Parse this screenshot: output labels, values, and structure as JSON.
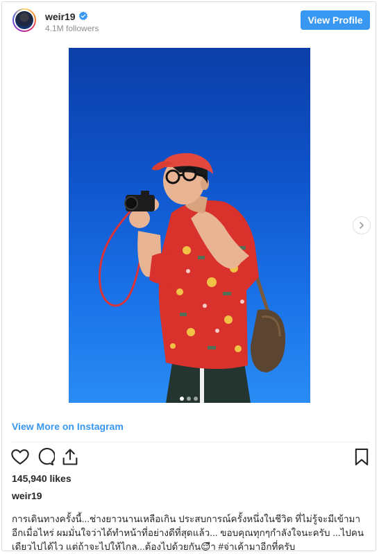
{
  "header": {
    "username": "weir19",
    "followers": "4.1M followers",
    "view_profile_label": "View Profile"
  },
  "post": {
    "carousel": {
      "count": 3,
      "active": 0
    },
    "view_more_label": "View More on Instagram",
    "likes": "145,940 likes",
    "author": "weir19",
    "caption": "การเดินทางครั้งนี้...ช่างยาวนานเหลือเกิน ประสบการณ์ครั้งหนึ่งในชีวิต ที่ไม่รู้จะมีเข้ามาอีกเมื่อไหร่ ผมมั่นใจว่าได้ทำหน้าที่อย่างดีที่สุดแล้ว... ขอบคุณทุกๆกำลังใจนะครับ ...ไปคนเดียวไปได้ไว แต่ถ้าจะไปให้ไกล...ต้องไปด้วยกัน😌ืา #จ่าเค้ามาอีกที่ครับ"
  },
  "icons": {
    "verified": "verified-badge-icon",
    "like": "heart-icon",
    "comment": "comment-icon",
    "share": "share-icon",
    "save": "bookmark-icon",
    "next": "chevron-right-icon"
  },
  "colors": {
    "accent": "#3897f0",
    "sky_top": "#0b3ea8",
    "sky_bottom": "#2a8cf4",
    "cap": "#e2483e",
    "shirt": "#d9312b"
  }
}
